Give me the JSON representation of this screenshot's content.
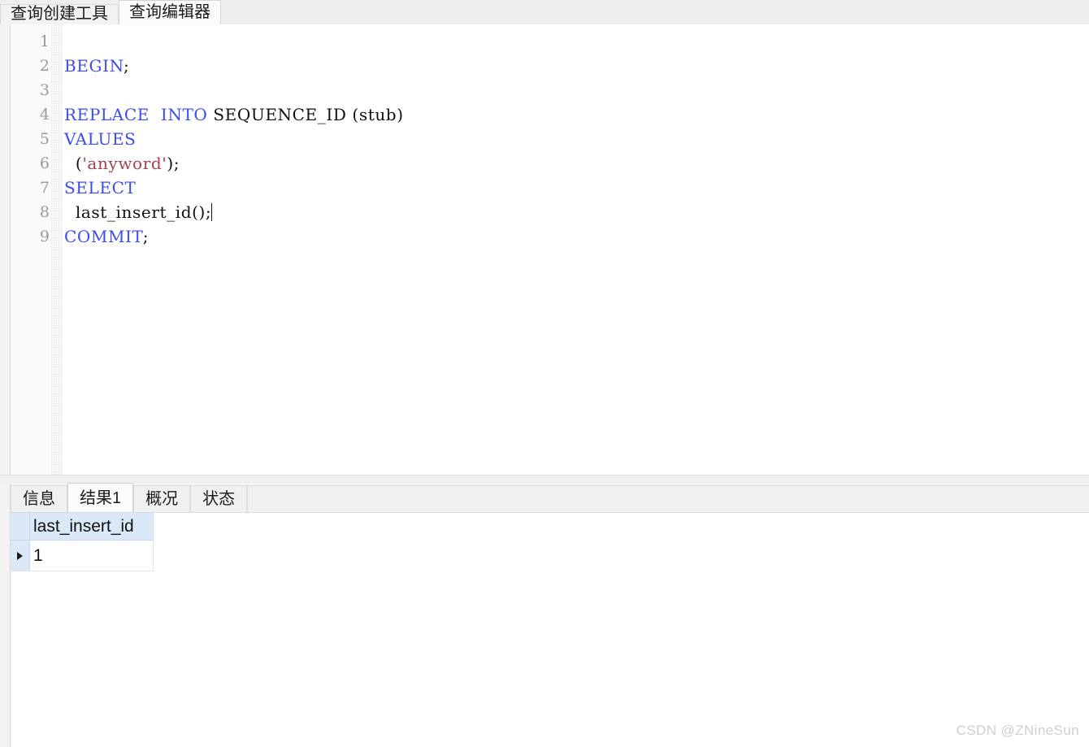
{
  "window": {
    "top_tabs": [
      {
        "label": "查询创建工具",
        "active": false,
        "name": "tab-query-builder"
      },
      {
        "label": "查询编辑器",
        "active": true,
        "name": "tab-query-editor"
      }
    ]
  },
  "editor": {
    "line_numbers": [
      "1",
      "2",
      "3",
      "4",
      "5",
      "6",
      "7",
      "8",
      "9"
    ],
    "lines": [
      {
        "n": "1",
        "tokens": []
      },
      {
        "n": "2",
        "tokens": [
          {
            "t": "BEGIN",
            "c": "kw"
          },
          {
            "t": ";",
            "c": "pn"
          }
        ]
      },
      {
        "n": "3",
        "tokens": []
      },
      {
        "n": "4",
        "tokens": [
          {
            "t": "REPLACE",
            "c": "kw"
          },
          {
            "t": "  ",
            "c": "pn"
          },
          {
            "t": "INTO",
            "c": "kw"
          },
          {
            "t": " SEQUENCE_ID (stub)",
            "c": "pn"
          }
        ]
      },
      {
        "n": "5",
        "tokens": [
          {
            "t": "VALUES",
            "c": "kw"
          }
        ]
      },
      {
        "n": "6",
        "tokens": [
          {
            "t": "  (",
            "c": "pn"
          },
          {
            "t": "'anyword'",
            "c": "str"
          },
          {
            "t": ");",
            "c": "pn"
          }
        ]
      },
      {
        "n": "7",
        "tokens": [
          {
            "t": "SELECT",
            "c": "kw"
          }
        ]
      },
      {
        "n": "8",
        "tokens": [
          {
            "t": "  last_insert_id();",
            "c": "pn"
          }
        ],
        "caret": true
      },
      {
        "n": "9",
        "tokens": [
          {
            "t": "COMMIT",
            "c": "kw"
          },
          {
            "t": ";",
            "c": "pn"
          }
        ]
      }
    ],
    "plain_text": "\nBEGIN;\n\nREPLACE  INTO SEQUENCE_ID (stub)\nVALUES\n  ('anyword');\nSELECT\n  last_insert_id();\nCOMMIT;",
    "cursor_line": 8,
    "colors": {
      "keyword": "#3b4cf0",
      "string": "#a3414e",
      "plain": "#101010",
      "line_number": "#9a9a9a"
    }
  },
  "results_panel": {
    "tabs": [
      {
        "label": "信息",
        "active": false,
        "name": "tab-info"
      },
      {
        "label": "结果1",
        "active": true,
        "name": "tab-result-1"
      },
      {
        "label": "概况",
        "active": false,
        "name": "tab-profile"
      },
      {
        "label": "状态",
        "active": false,
        "name": "tab-status"
      }
    ],
    "grid": {
      "columns": [
        "last_insert_id"
      ],
      "rows": [
        {
          "indicator": "▶",
          "cells": [
            "1"
          ]
        }
      ],
      "header_bg": "#dbe8f7"
    }
  },
  "watermark": {
    "text": "CSDN @ZNineSun"
  }
}
